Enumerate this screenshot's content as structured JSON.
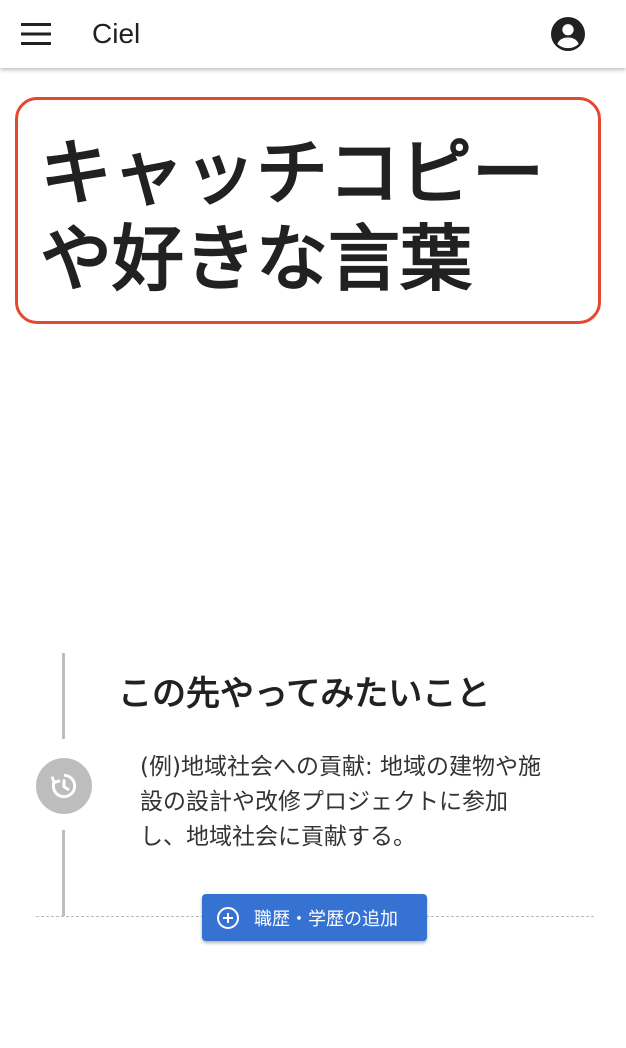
{
  "app": {
    "title": "Ciel"
  },
  "header": {
    "menu_icon": "hamburger-menu-icon",
    "account_icon": "account-circle-icon"
  },
  "catchphrase": {
    "text": "キャッチコピー\nや好きな言葉",
    "border_color": "#e5482e"
  },
  "timeline": {
    "title": "この先やってみたいこと",
    "body": "(例)地域社会への貢献: 地域の建物や施設の設計や改修プロジェクトに参加し、地域社会に貢献する。",
    "dot_icon": "history-icon"
  },
  "actions": {
    "add_history_label": "職歴・学歴の追加",
    "add_icon": "add-circle-icon",
    "button_color": "#3572d1"
  }
}
